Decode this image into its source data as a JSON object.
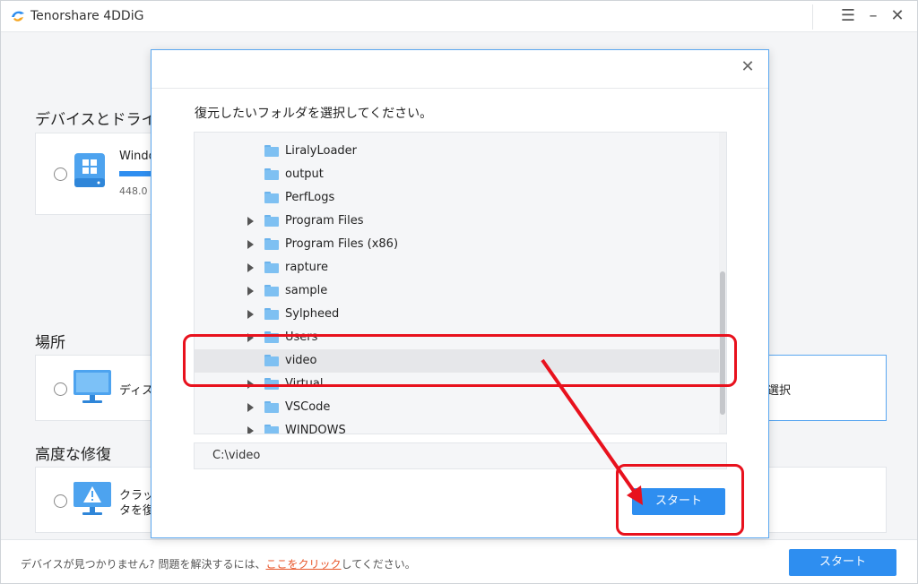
{
  "app": {
    "title": "Tenorshare 4DDiG"
  },
  "window_controls": {
    "menu": "☰",
    "minimize": "–",
    "close": "✕"
  },
  "sections": {
    "devices": {
      "title": "デバイスとドライ",
      "drive_name": "Windo",
      "drive_size": "448.0 G"
    },
    "location": {
      "title": "場所",
      "desktop_label": "ディス",
      "folder_select_label": "選択"
    },
    "advanced": {
      "title": "高度な修復",
      "crash_line1": "クラッ",
      "crash_line2": "タを復"
    }
  },
  "footer": {
    "text_prefix": "デバイスが見つかりません? 問題を解決するには、",
    "link": "ここをクリック",
    "text_suffix": "してください。",
    "start": "スタート"
  },
  "dialog": {
    "prompt": "復元したいフォルダを選択してください。",
    "close": "✕",
    "folders": [
      {
        "name": "LiralyLoader",
        "expandable": false
      },
      {
        "name": "output",
        "expandable": false
      },
      {
        "name": "PerfLogs",
        "expandable": false
      },
      {
        "name": "Program Files",
        "expandable": true
      },
      {
        "name": "Program Files (x86)",
        "expandable": true
      },
      {
        "name": "rapture",
        "expandable": true
      },
      {
        "name": "sample",
        "expandable": true
      },
      {
        "name": "Sylpheed",
        "expandable": true
      },
      {
        "name": "Users",
        "expandable": true
      },
      {
        "name": "video",
        "expandable": false,
        "selected": true
      },
      {
        "name": "Virtual",
        "expandable": true
      },
      {
        "name": "VSCode",
        "expandable": true
      },
      {
        "name": "WINDOWS",
        "expandable": true
      }
    ],
    "path": "C:\\video",
    "start": "スタート"
  },
  "colors": {
    "accent": "#2e8ef0",
    "annotation": "#e8111d",
    "link": "#e8562a"
  }
}
